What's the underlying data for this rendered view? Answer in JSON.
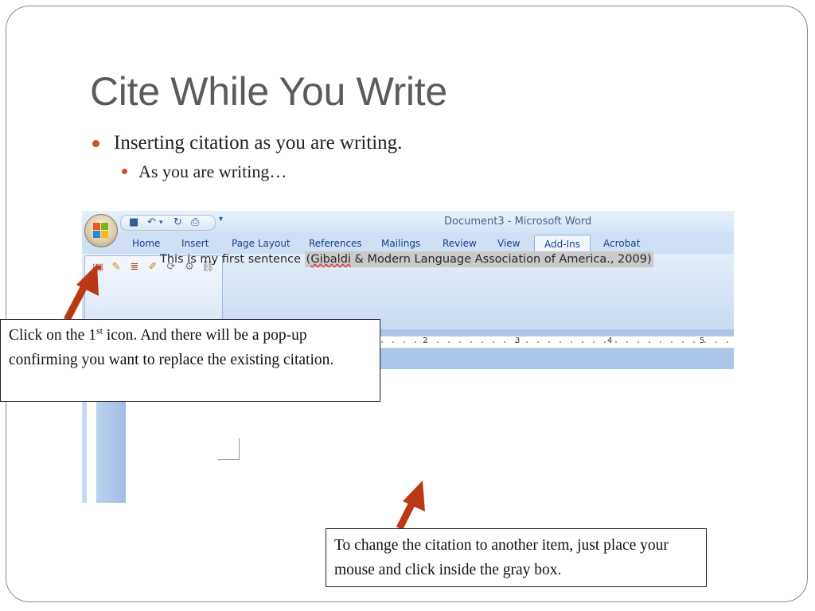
{
  "slide": {
    "title": "Cite While You Write",
    "bullets": [
      "Inserting citation as you are writing.",
      "As you are writing…"
    ]
  },
  "word": {
    "window_title": "Document3 - Microsoft Word",
    "tabs": [
      "Home",
      "Insert",
      "Page Layout",
      "References",
      "Mailings",
      "Review",
      "View",
      "Add-Ins",
      "Acrobat"
    ],
    "active_tab": "Add-Ins",
    "ruler_numbers": [
      "2",
      "3",
      "4",
      "5"
    ],
    "document_text": "This is my first sentence",
    "citation_prefix": "(",
    "citation_author": "Gibaldi",
    "citation_rest": " & Modern Language Association of America., 2009)"
  },
  "callouts": {
    "first_part1": "Click on the 1",
    "first_sup": "st",
    "first_part2": " icon.  And there will be a pop-up confirming you want to replace the existing citation.",
    "second": "To change the citation to another item, just place your mouse and click inside the gray box."
  },
  "colors": {
    "bullet": "#d1502a",
    "arrow": "#b83a14",
    "title": "#5b5b5b"
  }
}
